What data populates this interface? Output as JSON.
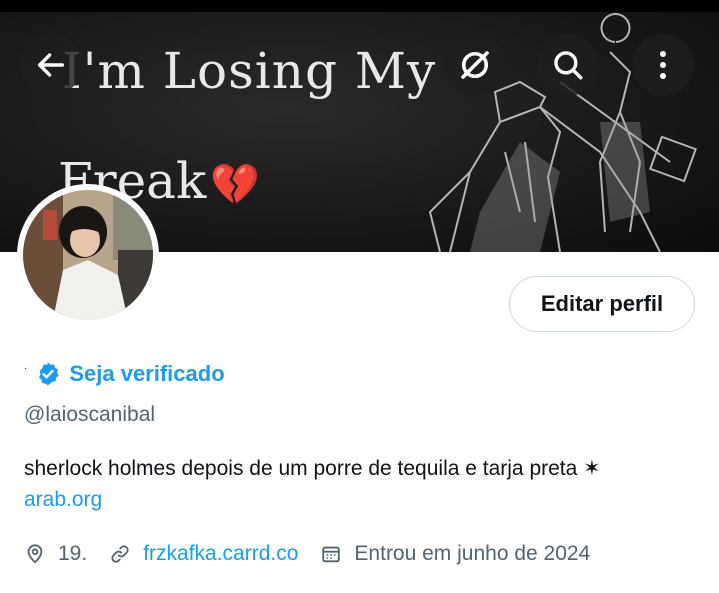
{
  "banner": {
    "line1": "I'm Losing My",
    "line2": "Freak",
    "emoji": "💔"
  },
  "toolbar": {
    "back_icon": "arrow-left-icon",
    "grok_icon": "grok-icon",
    "search_icon": "search-icon",
    "more_icon": "more-vertical-icon"
  },
  "profile": {
    "display_name": "·",
    "verify_label": "Seja verificado",
    "handle": "@laioscanibal",
    "bio": "sherlock holmes depois de um porre de tequila e tarja preta ✶",
    "bio_link": "arab.org",
    "edit_button": "Editar perfil",
    "location": "19.",
    "website": "frzkafka.carrd.co",
    "joined": "Entrou em junho de 2024"
  },
  "colors": {
    "accent": "#1d9bf0",
    "secondary_text": "#536471",
    "border": "#cfd9de"
  }
}
